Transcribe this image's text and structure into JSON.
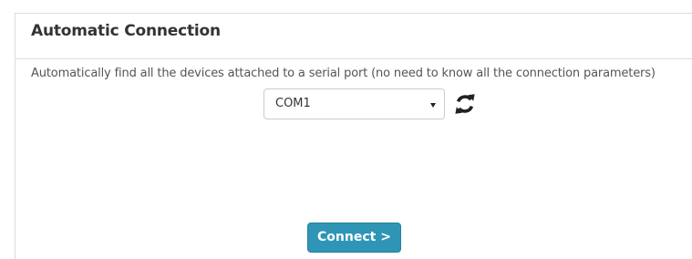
{
  "panel": {
    "title": "Automatic Connection",
    "description": "Automatically find all the devices attached to a serial port (no need to know all the connection parameters)"
  },
  "port_select": {
    "selected": "COM1",
    "arrow_icon": "caret-down-icon"
  },
  "refresh": {
    "icon": "refresh-icon"
  },
  "connect_button": {
    "label": "Connect >",
    "color": "#2f95b6"
  }
}
